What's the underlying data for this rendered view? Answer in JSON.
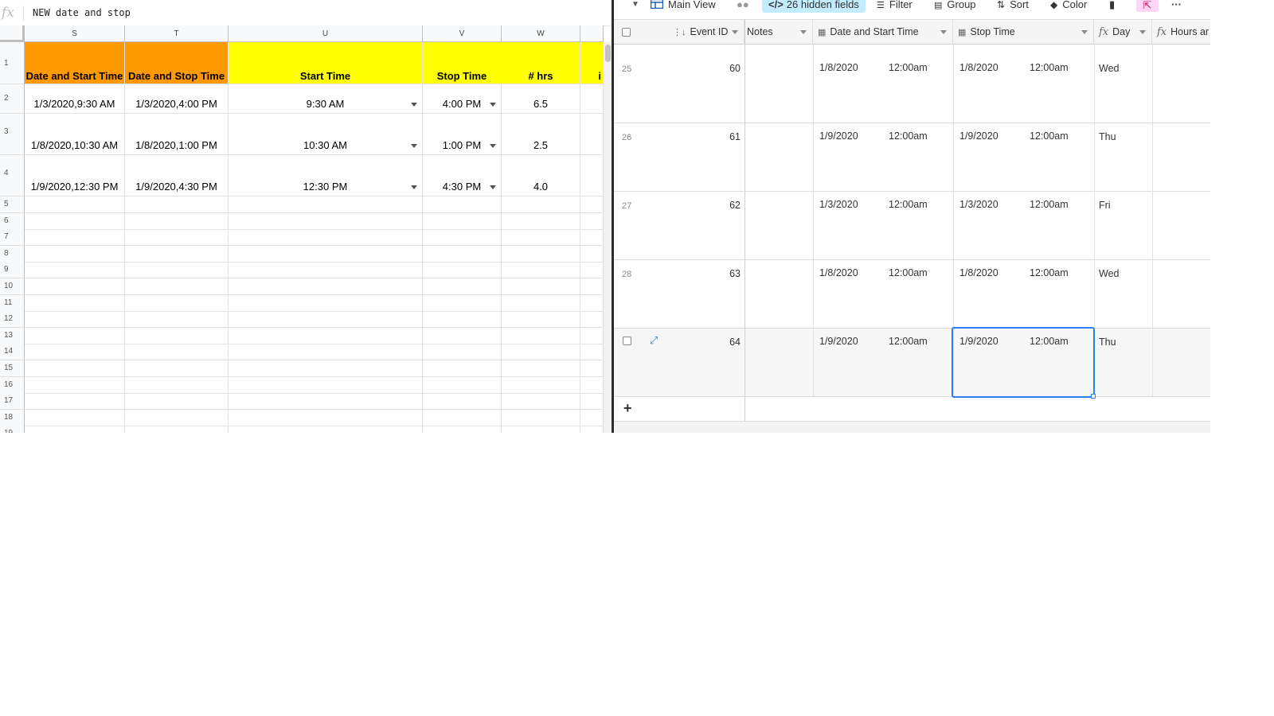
{
  "sheets": {
    "formula_bar": {
      "fx_label": "fx",
      "content": "NEW date and stop"
    },
    "columns": [
      "S",
      "T",
      "U",
      "V",
      "W"
    ],
    "header_row": {
      "row_number": "1",
      "cells": [
        "Date and Start Time",
        "Date and Stop Time",
        "Start Time",
        "Stop Time",
        "# hrs"
      ],
      "overflow_char": "i"
    },
    "data_rows": [
      {
        "row_number": "2",
        "date_start": "1/3/2020,9:30 AM",
        "date_stop": "1/3/2020,4:00 PM",
        "start_time": "9:30 AM",
        "stop_time": "4:00 PM",
        "hrs": "6.5"
      },
      {
        "row_number": "3",
        "date_start": "1/8/2020,10:30 AM",
        "date_stop": "1/8/2020,1:00 PM",
        "start_time": "10:30 AM",
        "stop_time": "1:00 PM",
        "hrs": "2.5"
      },
      {
        "row_number": "4",
        "date_start": "1/9/2020,12:30 PM",
        "date_stop": "1/9/2020,4:30 PM",
        "start_time": "12:30 PM",
        "stop_time": "4:30 PM",
        "hrs": "4.0"
      }
    ],
    "empty_row_numbers": [
      "5",
      "6",
      "7",
      "8",
      "9",
      "10",
      "11",
      "12",
      "13",
      "14",
      "15",
      "16",
      "17",
      "18",
      "19"
    ],
    "colors": {
      "orange_header": "#ff9900",
      "yellow_header": "#ffff00"
    }
  },
  "airtable": {
    "toolbar": {
      "view_name": "Main View",
      "hidden_fields": "26 hidden fields",
      "filter": "Filter",
      "group": "Group",
      "sort": "Sort",
      "color": "Color",
      "more": "···"
    },
    "columns": {
      "event_id": "Event ID",
      "notes": "Notes",
      "date_start": "Date and Start Time",
      "stop_time": "Stop Time",
      "day": "Day",
      "hours": "Hours ar"
    },
    "rows": [
      {
        "num": "25",
        "event_id": "60",
        "start_date": "1/8/2020",
        "start_time": "12:00am",
        "stop_date": "1/8/2020",
        "stop_time": "12:00am",
        "day": "Wed"
      },
      {
        "num": "26",
        "event_id": "61",
        "start_date": "1/9/2020",
        "start_time": "12:00am",
        "stop_date": "1/9/2020",
        "stop_time": "12:00am",
        "day": "Thu"
      },
      {
        "num": "27",
        "event_id": "62",
        "start_date": "1/3/2020",
        "start_time": "12:00am",
        "stop_date": "1/3/2020",
        "stop_time": "12:00am",
        "day": "Fri"
      },
      {
        "num": "28",
        "event_id": "63",
        "start_date": "1/8/2020",
        "start_time": "12:00am",
        "stop_date": "1/8/2020",
        "stop_time": "12:00am",
        "day": "Wed"
      },
      {
        "num": "",
        "event_id": "64",
        "start_date": "1/9/2020",
        "start_time": "12:00am",
        "stop_date": "1/9/2020",
        "stop_time": "12:00am",
        "day": "Thu"
      }
    ],
    "add_row_label": "+",
    "colors": {
      "selection": "#2d7ff9",
      "hidden_fields_bg": "#c4ecff"
    }
  }
}
